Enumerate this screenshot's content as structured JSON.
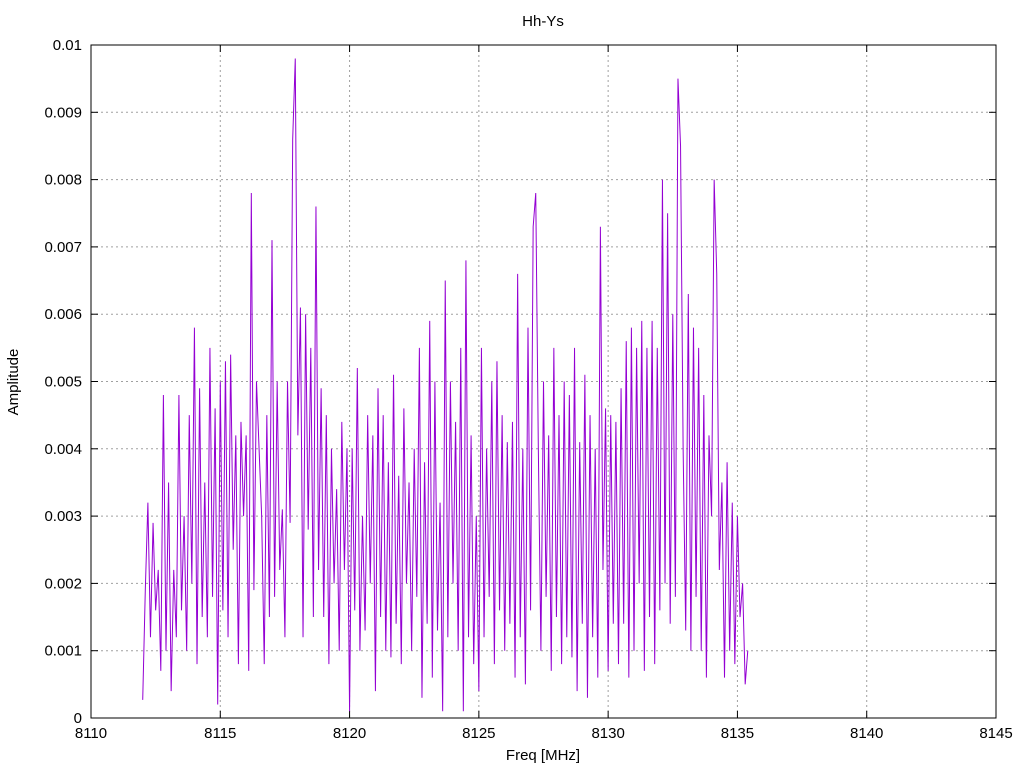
{
  "chart_data": {
    "type": "line",
    "title": "Hh-Ys",
    "xlabel": "Freq [MHz]",
    "ylabel": "Amplitude",
    "xlim": [
      8110,
      8145
    ],
    "ylim": [
      0,
      0.01
    ],
    "x_ticks": [
      "8110",
      "8115",
      "8120",
      "8125",
      "8130",
      "8135",
      "8140",
      "8145"
    ],
    "y_ticks": [
      "0",
      "0.001",
      "0.002",
      "0.003",
      "0.004",
      "0.005",
      "0.006",
      "0.007",
      "0.008",
      "0.009",
      "0.01"
    ],
    "grid": true,
    "legend": "none",
    "series": [
      {
        "color": "#9400d3",
        "x_start": 8112.0,
        "x_step": 0.1,
        "values": [
          0.00027,
          0.0019,
          0.0032,
          0.0012,
          0.0029,
          0.0016,
          0.0022,
          0.0007,
          0.0048,
          0.001,
          0.0035,
          0.0004,
          0.0022,
          0.0012,
          0.0048,
          0.0016,
          0.003,
          0.001,
          0.0045,
          0.002,
          0.0058,
          0.0008,
          0.0049,
          0.0015,
          0.0035,
          0.0012,
          0.0055,
          0.0018,
          0.0046,
          0.0002,
          0.005,
          0.0016,
          0.0053,
          0.0012,
          0.0054,
          0.0025,
          0.0042,
          0.0008,
          0.0044,
          0.003,
          0.0042,
          0.0007,
          0.0078,
          0.0019,
          0.005,
          0.004,
          0.003,
          0.0008,
          0.0045,
          0.0015,
          0.0071,
          0.0018,
          0.005,
          0.0022,
          0.0031,
          0.0012,
          0.005,
          0.0029,
          0.0086,
          0.0098,
          0.0042,
          0.0061,
          0.0012,
          0.006,
          0.0028,
          0.0055,
          0.0015,
          0.0076,
          0.0022,
          0.0049,
          0.0015,
          0.0045,
          0.0008,
          0.004,
          0.002,
          0.0034,
          0.001,
          0.0044,
          0.0022,
          0.004,
          0.0001,
          0.004,
          0.0016,
          0.0052,
          0.001,
          0.003,
          0.0013,
          0.0045,
          0.002,
          0.0042,
          0.0004,
          0.0049,
          0.0015,
          0.0045,
          0.001,
          0.0038,
          0.0009,
          0.0051,
          0.0014,
          0.0036,
          0.0008,
          0.0046,
          0.002,
          0.0035,
          0.001,
          0.004,
          0.0018,
          0.0055,
          0.0003,
          0.0038,
          0.0014,
          0.0059,
          0.0006,
          0.005,
          0.0013,
          0.0032,
          0.0001,
          0.0065,
          0.0012,
          0.005,
          0.002,
          0.0044,
          0.001,
          0.0055,
          0.0001,
          0.0068,
          0.0012,
          0.0042,
          0.0008,
          0.003,
          0.0004,
          0.0055,
          0.0012,
          0.004,
          0.0018,
          0.005,
          0.0008,
          0.0053,
          0.0016,
          0.0045,
          0.001,
          0.0041,
          0.0014,
          0.0044,
          0.0006,
          0.0066,
          0.0012,
          0.004,
          0.0005,
          0.0058,
          0.0016,
          0.0073,
          0.0078,
          0.004,
          0.001,
          0.005,
          0.0018,
          0.0042,
          0.0007,
          0.0055,
          0.0015,
          0.0045,
          0.0008,
          0.005,
          0.0012,
          0.0048,
          0.0009,
          0.0055,
          0.0004,
          0.0041,
          0.0014,
          0.0051,
          0.0003,
          0.0045,
          0.0012,
          0.004,
          0.0006,
          0.0073,
          0.0022,
          0.0046,
          0.0007,
          0.0045,
          0.0014,
          0.0044,
          0.0008,
          0.0049,
          0.0014,
          0.0056,
          0.0006,
          0.0058,
          0.001,
          0.0055,
          0.002,
          0.0059,
          0.0007,
          0.0055,
          0.0015,
          0.0059,
          0.0008,
          0.0055,
          0.0016,
          0.008,
          0.002,
          0.0075,
          0.0014,
          0.006,
          0.0018,
          0.0095,
          0.0085,
          0.004,
          0.0013,
          0.0063,
          0.001,
          0.0058,
          0.0018,
          0.0055,
          0.001,
          0.0048,
          0.0006,
          0.0042,
          0.003,
          0.008,
          0.0066,
          0.0022,
          0.0035,
          0.0006,
          0.0038,
          0.001,
          0.0032,
          0.0008,
          0.003,
          0.0015,
          0.002,
          0.0005,
          0.001
        ]
      }
    ]
  }
}
